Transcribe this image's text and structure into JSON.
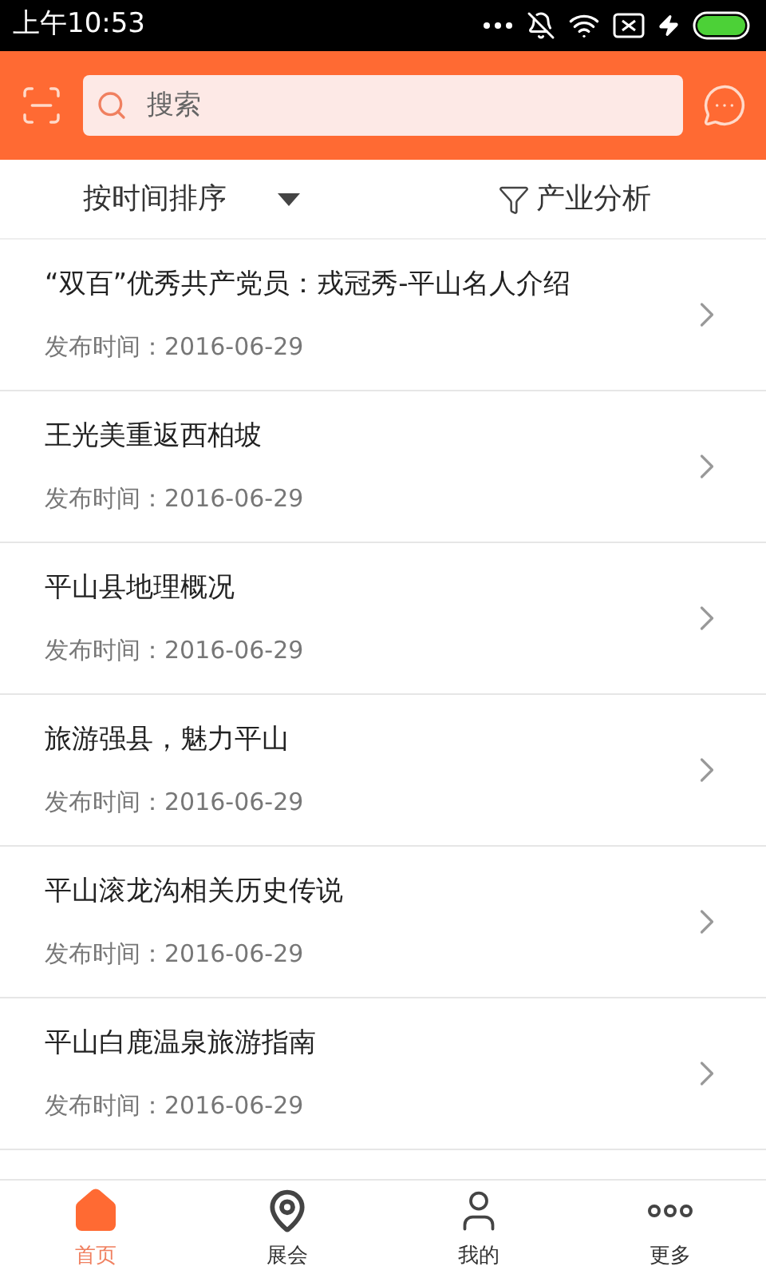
{
  "status_bar": {
    "time": "上午10:53"
  },
  "search": {
    "placeholder": "搜索"
  },
  "filter_bar": {
    "sort": "按时间排序",
    "analysis": "产业分析"
  },
  "articles": [
    {
      "title": "“双百”优秀共产党员：戎冠秀-平山名人介绍",
      "date": "发布时间：2016-06-29"
    },
    {
      "title": "王光美重返西柏坡",
      "date": "发布时间：2016-06-29"
    },
    {
      "title": "平山县地理概况",
      "date": "发布时间：2016-06-29"
    },
    {
      "title": "旅游强县，魅力平山",
      "date": "发布时间：2016-06-29"
    },
    {
      "title": "平山滚龙沟相关历史传说",
      "date": "发布时间：2016-06-29"
    },
    {
      "title": "平山白鹿温泉旅游指南",
      "date": "发布时间：2016-06-29"
    }
  ],
  "tabs": [
    {
      "label": "首页",
      "kind": "home",
      "selected": true
    },
    {
      "label": "展会",
      "kind": "pin",
      "selected": false
    },
    {
      "label": "我的",
      "kind": "user",
      "selected": false
    },
    {
      "label": "更多",
      "kind": "more",
      "selected": false
    }
  ]
}
